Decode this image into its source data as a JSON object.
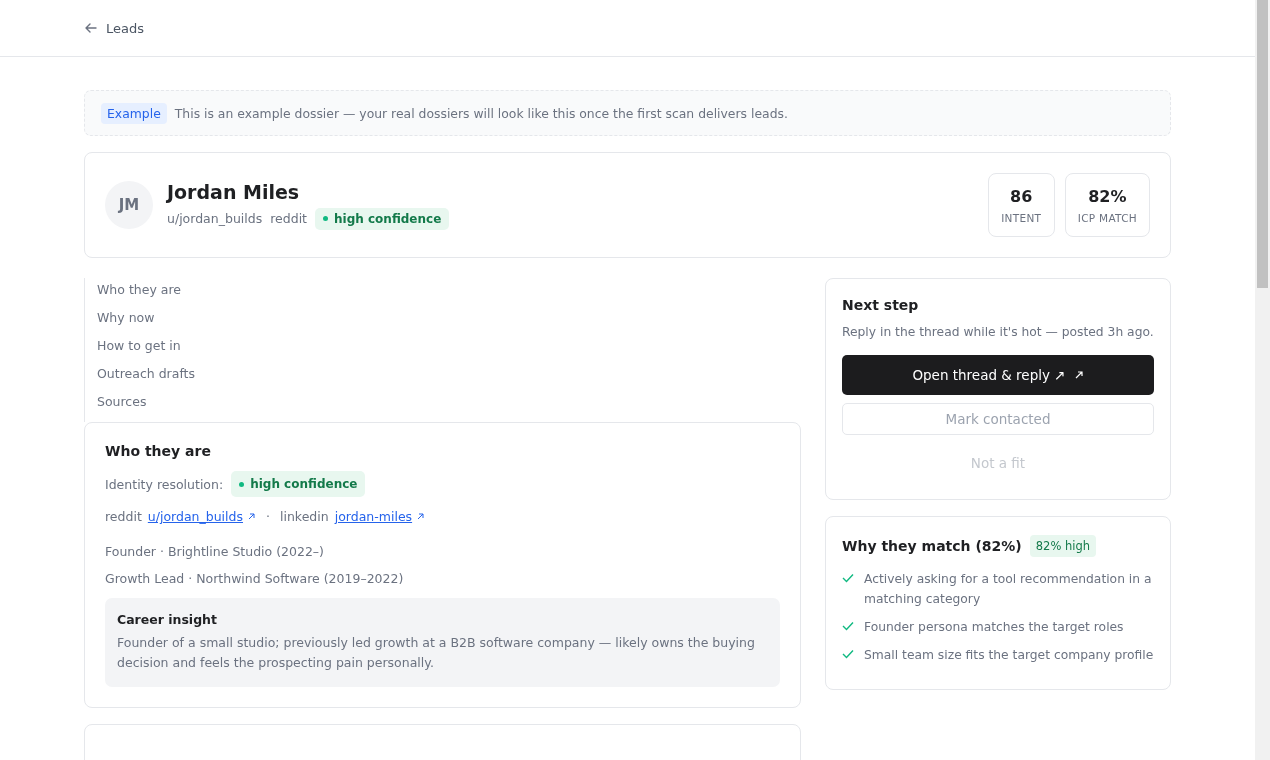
{
  "header": {
    "back_label": "Leads"
  },
  "notice": {
    "badge": "Example",
    "text": "This is an example dossier — your real dossiers will look like this once the first scan delivers leads."
  },
  "profile": {
    "initials": "JM",
    "name": "Jordan Miles",
    "handle": "u/jordan_builds",
    "platform": "reddit",
    "confidence": "high confidence",
    "stats": [
      {
        "value": "86",
        "label": "INTENT"
      },
      {
        "value": "82%",
        "label": "ICP MATCH"
      }
    ]
  },
  "section_nav": [
    {
      "label": "Who they are"
    },
    {
      "label": "Why now"
    },
    {
      "label": "How to get in"
    },
    {
      "label": "Outreach drafts"
    },
    {
      "label": "Sources"
    }
  ],
  "who_they_are": {
    "title": "Who they are",
    "identity_label": "Identity resolution:",
    "identity_badge": "high confidence",
    "profiles": [
      {
        "network": "reddit",
        "link": "u/jordan_builds"
      },
      {
        "network": "linkedin",
        "link": "jordan-miles"
      }
    ],
    "separator": "·",
    "roles": [
      "Founder · Brightline Studio (2022–)",
      "Growth Lead · Northwind Software (2019–2022)"
    ],
    "insight": {
      "title": "Career insight",
      "text": "Founder of a small studio; previously led growth at a B2B software company — likely owns the buying decision and feels the prospecting pain personally."
    }
  },
  "next_step": {
    "title": "Next step",
    "text": "Reply in the thread while it's hot — posted 3h ago.",
    "buttons": [
      {
        "label": "Open thread & reply ↗",
        "kind": "primary"
      },
      {
        "label": "Mark contacted",
        "kind": "outline"
      },
      {
        "label": "Not a fit",
        "kind": "ghost"
      }
    ]
  },
  "match": {
    "title": "Why they match (82%)",
    "badge": "82% high",
    "reasons": [
      "Actively asking for a tool recommendation in a matching category",
      "Founder persona matches the target roles",
      "Small team size fits the target company profile"
    ]
  }
}
